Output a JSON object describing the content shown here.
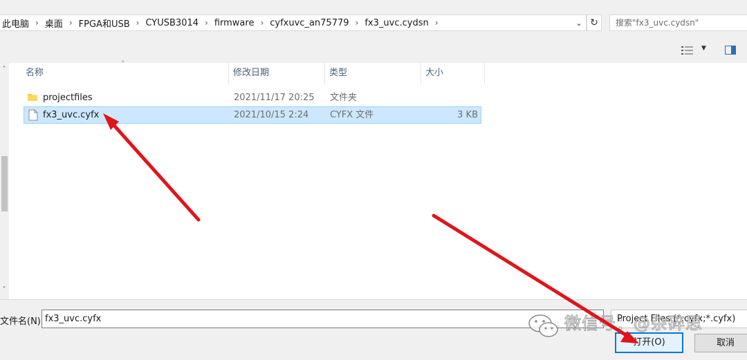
{
  "breadcrumb": [
    "此电脑",
    "桌面",
    "FPGA和USB",
    "CYUSB3014",
    "firmware",
    "cyfxuvc_an75779",
    "fx3_uvc.cydsn"
  ],
  "search": {
    "placeholder": "搜索\"fx3_uvc.cydsn\""
  },
  "columns": {
    "name": "名称",
    "modified": "修改日期",
    "type": "类型",
    "size": "大小"
  },
  "files": [
    {
      "name": "projectfiles",
      "modified": "2021/11/17 20:25",
      "type": "文件夹",
      "size": "",
      "icon": "folder-icon",
      "selected": false
    },
    {
      "name": "fx3_uvc.cyfx",
      "modified": "2021/10/15 2:24",
      "type": "CYFX 文件",
      "size": "3 KB",
      "icon": "file-icon",
      "selected": true
    }
  ],
  "bottom": {
    "filename_label": "文件名(N):",
    "filename_value": "fx3_uvc.cyfx",
    "filetype": "Project Files (*.cyfx;*.cyfx)",
    "open_label": "打开(O)",
    "cancel_label": "取消"
  },
  "watermark": {
    "text": "微信号：@杂碎思"
  },
  "colors": {
    "selection_bg": "#cce8ff",
    "selection_border": "#99d1ff",
    "arrow": "#e0141b",
    "accent": "#0078d7"
  }
}
